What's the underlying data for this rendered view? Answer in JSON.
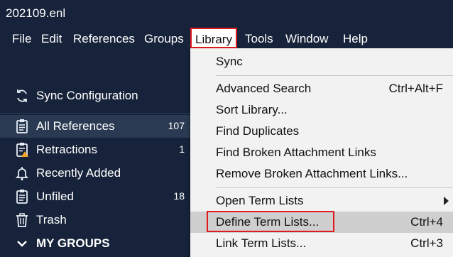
{
  "window": {
    "title": "202109.enl"
  },
  "menubar": {
    "items": [
      {
        "label": "File"
      },
      {
        "label": "Edit"
      },
      {
        "label": "References"
      },
      {
        "label": "Groups"
      },
      {
        "label": "Library"
      },
      {
        "label": "Tools"
      },
      {
        "label": "Window"
      },
      {
        "label": "Help"
      }
    ],
    "active": "Library"
  },
  "sidebar": {
    "sync": {
      "label": "Sync Configuration",
      "icon": "sync-icon"
    },
    "items": [
      {
        "label": "All References",
        "count": "107",
        "icon": "clipboard-icon",
        "selected": true
      },
      {
        "label": "Retractions",
        "count": "1",
        "icon": "retraction-icon"
      },
      {
        "label": "Recently Added",
        "count": "",
        "icon": "bell-icon"
      },
      {
        "label": "Unfiled",
        "count": "18",
        "icon": "clipboard-icon"
      },
      {
        "label": "Trash",
        "count": "",
        "icon": "trash-icon"
      }
    ],
    "groups_header": {
      "label": "MY GROUPS",
      "icon": "chevron-down-icon"
    }
  },
  "library_menu": {
    "items": [
      {
        "label": "Sync",
        "shortcut": ""
      },
      {
        "label": "Advanced Search",
        "shortcut": "Ctrl+Alt+F"
      },
      {
        "label": "Sort Library...",
        "shortcut": ""
      },
      {
        "label": "Find Duplicates",
        "shortcut": ""
      },
      {
        "label": "Find Broken Attachment Links",
        "shortcut": ""
      },
      {
        "label": "Remove Broken Attachment Links...",
        "shortcut": ""
      },
      {
        "label": "Open Term Lists",
        "shortcut": "",
        "submenu": true
      },
      {
        "label": "Define Term Lists...",
        "shortcut": "Ctrl+4",
        "highlighted": true
      },
      {
        "label": "Link Term Lists...",
        "shortcut": "Ctrl+3"
      }
    ]
  },
  "colors": {
    "background": "#16233a",
    "selected_row": "#2a3a52",
    "menu_bg": "#f2f2f2",
    "menu_highlight": "#cfcfcf",
    "annotation_red": "#e0191e"
  }
}
